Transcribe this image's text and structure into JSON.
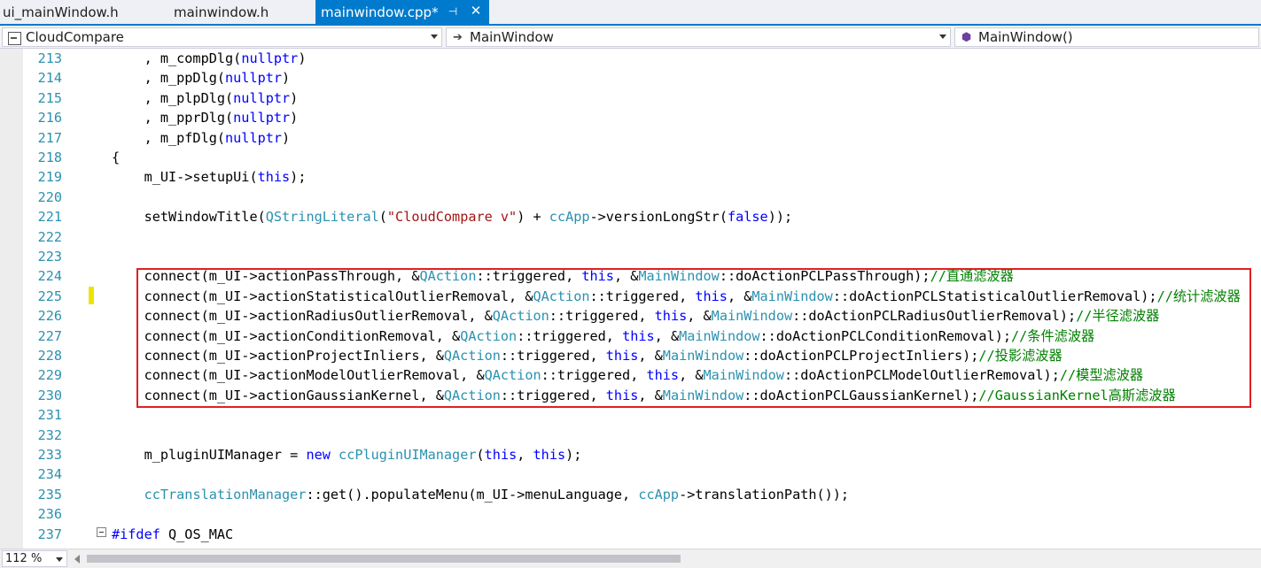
{
  "tabs": [
    {
      "label": "ui_mainWindow.h"
    },
    {
      "label": "mainwindow.h"
    },
    {
      "label": "mainwindow.cpp*",
      "pin": "⊣",
      "close": "✕"
    }
  ],
  "nav": {
    "project": "CloudCompare",
    "scope": "MainWindow",
    "member": "MainWindow()"
  },
  "editor": {
    "lines": [
      {
        "n": "213",
        "segs": [
          {
            "t": "    , m_compDlg("
          },
          {
            "t": "nullptr",
            "c": "kw"
          },
          {
            "t": ")"
          }
        ]
      },
      {
        "n": "214",
        "segs": [
          {
            "t": "    , m_ppDlg("
          },
          {
            "t": "nullptr",
            "c": "kw"
          },
          {
            "t": ")"
          }
        ]
      },
      {
        "n": "215",
        "segs": [
          {
            "t": "    , m_plpDlg("
          },
          {
            "t": "nullptr",
            "c": "kw"
          },
          {
            "t": ")"
          }
        ]
      },
      {
        "n": "216",
        "segs": [
          {
            "t": "    , m_pprDlg("
          },
          {
            "t": "nullptr",
            "c": "kw"
          },
          {
            "t": ")"
          }
        ]
      },
      {
        "n": "217",
        "segs": [
          {
            "t": "    , m_pfDlg("
          },
          {
            "t": "nullptr",
            "c": "kw"
          },
          {
            "t": ")"
          }
        ]
      },
      {
        "n": "218",
        "segs": [
          {
            "t": "{"
          }
        ]
      },
      {
        "n": "219",
        "segs": [
          {
            "t": "    m_UI->setupUi("
          },
          {
            "t": "this",
            "c": "kw"
          },
          {
            "t": ");"
          }
        ]
      },
      {
        "n": "220",
        "segs": []
      },
      {
        "n": "221",
        "segs": [
          {
            "t": "    setWindowTitle("
          },
          {
            "t": "QStringLiteral",
            "c": "ty"
          },
          {
            "t": "("
          },
          {
            "t": "\"CloudCompare v\"",
            "c": "st"
          },
          {
            "t": ") + "
          },
          {
            "t": "ccApp",
            "c": "ty"
          },
          {
            "t": "->versionLongStr("
          },
          {
            "t": "false",
            "c": "kw"
          },
          {
            "t": "));"
          }
        ]
      },
      {
        "n": "222",
        "segs": []
      },
      {
        "n": "223",
        "segs": []
      },
      {
        "n": "224",
        "segs": [
          {
            "t": "    connect(m_UI->actionPassThrough, &"
          },
          {
            "t": "QAction",
            "c": "ty"
          },
          {
            "t": "::triggered, "
          },
          {
            "t": "this",
            "c": "kw"
          },
          {
            "t": ", &"
          },
          {
            "t": "MainWindow",
            "c": "ty"
          },
          {
            "t": "::doActionPCLPassThrough);"
          },
          {
            "t": "//直通滤波器",
            "c": "cm"
          }
        ]
      },
      {
        "n": "225",
        "segs": [
          {
            "t": "    connect(m_UI->actionStatisticalOutlierRemoval, &"
          },
          {
            "t": "QAction",
            "c": "ty"
          },
          {
            "t": "::triggered, "
          },
          {
            "t": "this",
            "c": "kw"
          },
          {
            "t": ", &"
          },
          {
            "t": "MainWindow",
            "c": "ty"
          },
          {
            "t": "::doActionPCLStatisticalOutlierRemoval);"
          },
          {
            "t": "//统计滤波器",
            "c": "cm"
          }
        ]
      },
      {
        "n": "226",
        "segs": [
          {
            "t": "    connect(m_UI->actionRadiusOutlierRemoval, &"
          },
          {
            "t": "QAction",
            "c": "ty"
          },
          {
            "t": "::triggered, "
          },
          {
            "t": "this",
            "c": "kw"
          },
          {
            "t": ", &"
          },
          {
            "t": "MainWindow",
            "c": "ty"
          },
          {
            "t": "::doActionPCLRadiusOutlierRemoval);"
          },
          {
            "t": "//半径滤波器",
            "c": "cm"
          }
        ]
      },
      {
        "n": "227",
        "segs": [
          {
            "t": "    connect(m_UI->actionConditionRemoval, &"
          },
          {
            "t": "QAction",
            "c": "ty"
          },
          {
            "t": "::triggered, "
          },
          {
            "t": "this",
            "c": "kw"
          },
          {
            "t": ", &"
          },
          {
            "t": "MainWindow",
            "c": "ty"
          },
          {
            "t": "::doActionPCLConditionRemoval);"
          },
          {
            "t": "//条件滤波器",
            "c": "cm"
          }
        ]
      },
      {
        "n": "228",
        "segs": [
          {
            "t": "    connect(m_UI->actionProjectInliers, &"
          },
          {
            "t": "QAction",
            "c": "ty"
          },
          {
            "t": "::triggered, "
          },
          {
            "t": "this",
            "c": "kw"
          },
          {
            "t": ", &"
          },
          {
            "t": "MainWindow",
            "c": "ty"
          },
          {
            "t": "::doActionPCLProjectInliers);"
          },
          {
            "t": "//投影滤波器",
            "c": "cm"
          }
        ]
      },
      {
        "n": "229",
        "segs": [
          {
            "t": "    connect(m_UI->actionModelOutlierRemoval, &"
          },
          {
            "t": "QAction",
            "c": "ty"
          },
          {
            "t": "::triggered, "
          },
          {
            "t": "this",
            "c": "kw"
          },
          {
            "t": ", &"
          },
          {
            "t": "MainWindow",
            "c": "ty"
          },
          {
            "t": "::doActionPCLModelOutlierRemoval);"
          },
          {
            "t": "//模型滤波器",
            "c": "cm"
          }
        ]
      },
      {
        "n": "230",
        "segs": [
          {
            "t": "    connect(m_UI->actionGaussianKernel, &"
          },
          {
            "t": "QAction",
            "c": "ty"
          },
          {
            "t": "::triggered, "
          },
          {
            "t": "this",
            "c": "kw"
          },
          {
            "t": ", &"
          },
          {
            "t": "MainWindow",
            "c": "ty"
          },
          {
            "t": "::doActionPCLGaussianKernel);"
          },
          {
            "t": "//GaussianKernel高斯滤波器",
            "c": "cm"
          }
        ]
      },
      {
        "n": "231",
        "segs": []
      },
      {
        "n": "232",
        "segs": []
      },
      {
        "n": "233",
        "segs": [
          {
            "t": "    m_pluginUIManager = "
          },
          {
            "t": "new",
            "c": "kw"
          },
          {
            "t": " "
          },
          {
            "t": "ccPluginUIManager",
            "c": "ty"
          },
          {
            "t": "("
          },
          {
            "t": "this",
            "c": "kw"
          },
          {
            "t": ", "
          },
          {
            "t": "this",
            "c": "kw"
          },
          {
            "t": ");"
          }
        ]
      },
      {
        "n": "234",
        "segs": []
      },
      {
        "n": "235",
        "segs": [
          {
            "t": "    "
          },
          {
            "t": "ccTranslationManager",
            "c": "ty"
          },
          {
            "t": "::get().populateMenu(m_UI->menuLanguage, "
          },
          {
            "t": "ccApp",
            "c": "ty"
          },
          {
            "t": "->translationPath());"
          }
        ]
      },
      {
        "n": "236",
        "segs": []
      },
      {
        "n": "237",
        "segs": [
          {
            "t": "#ifdef",
            "c": "kw"
          },
          {
            "t": " Q_OS_MAC"
          }
        ]
      }
    ]
  },
  "statusbar": {
    "zoom": "112 %"
  },
  "colors": {
    "accent": "#007acc",
    "keyword": "#0000ff",
    "type": "#2b91af",
    "string": "#a31515",
    "comment": "#008000",
    "highlight_box": "#e02020",
    "change_marker": "#efe300"
  },
  "icons": {
    "project": "project-icon",
    "scope": "arrow-right-icon",
    "member": "method-cube-icon"
  }
}
